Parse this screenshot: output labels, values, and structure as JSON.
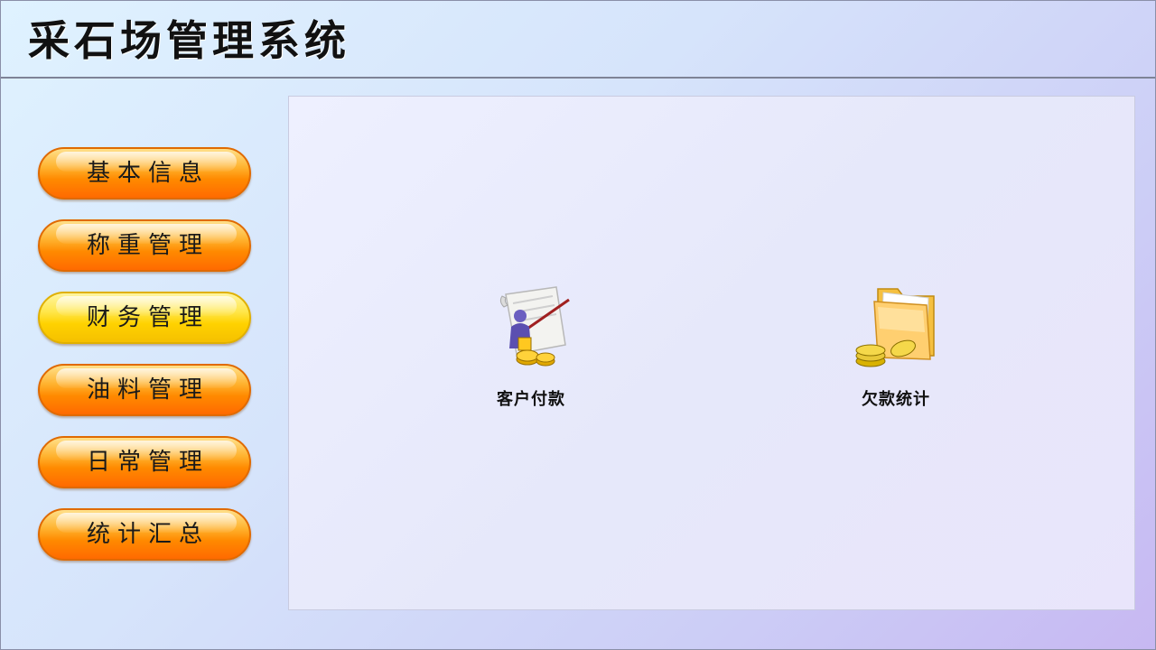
{
  "app": {
    "title": "采石场管理系统"
  },
  "sidebar": {
    "items": [
      {
        "label": "基本信息",
        "active": false
      },
      {
        "label": "称重管理",
        "active": false
      },
      {
        "label": "财务管理",
        "active": true
      },
      {
        "label": "油料管理",
        "active": false
      },
      {
        "label": "日常管理",
        "active": false
      },
      {
        "label": "统计汇总",
        "active": false
      }
    ]
  },
  "main": {
    "functions": [
      {
        "label": "客户付款",
        "icon": "customer-payment-icon"
      },
      {
        "label": "欠款统计",
        "icon": "debt-statistics-icon"
      }
    ]
  },
  "colors": {
    "button_orange": "#ff8a00",
    "button_active_yellow": "#ffe64a"
  }
}
